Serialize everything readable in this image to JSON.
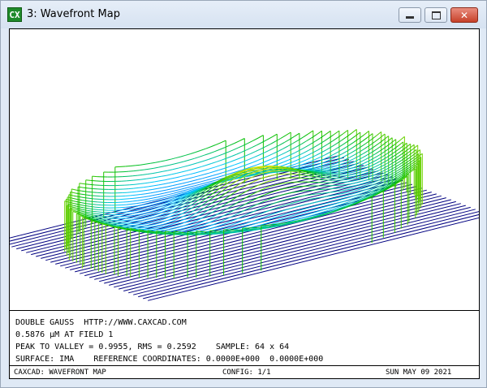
{
  "window": {
    "title": "3: Wavefront Map",
    "app_icon_text": "CX",
    "controls": [
      "minimize",
      "maximize",
      "close"
    ]
  },
  "info": {
    "line1": "DOUBLE GAUSS  HTTP://WWW.CAXCAD.COM",
    "line2": "0.5876 µM AT FIELD 1",
    "line3": "PEAK TO VALLEY = 0.9955, RMS = 0.2592    SAMPLE: 64 x 64",
    "line4": "SURFACE: IMA    REFERENCE COORDINATES: 0.0000E+000  0.0000E+000"
  },
  "footer": {
    "left": "CAXCAD: WAVEFRONT MAP",
    "center": "CONFIG: 1/1",
    "right": "SUN MAY 09 2021"
  },
  "plot": {
    "description_free": true,
    "colors": {
      "low": "#000080",
      "high": "#ff0000"
    }
  }
}
